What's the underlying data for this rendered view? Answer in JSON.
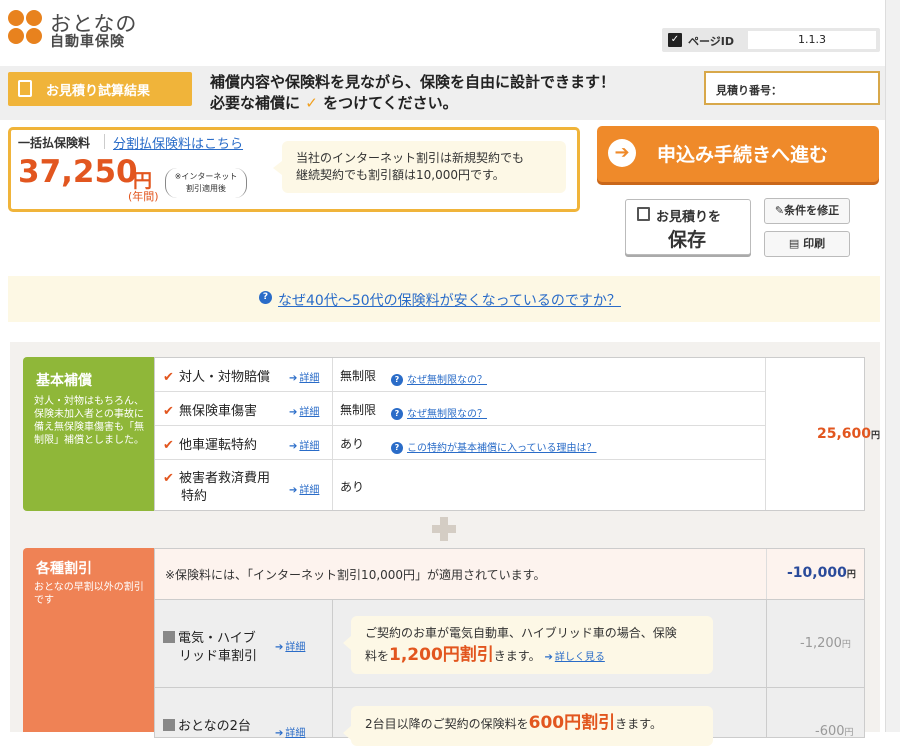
{
  "header": {
    "logo_line1": "おとなの",
    "logo_line2": "自動車保険",
    "page_id_label": "ページID",
    "page_id_value": "1.1.3"
  },
  "band": {
    "tag_label": "お見積り試算結果",
    "line1": "補償内容や保険料を見ながら、保険を自由に設計できます！",
    "line2_pre": "必要な補償に",
    "line2_check": "✓",
    "line2_post": "をつけてください。",
    "quote_number_label": "見積り番号："
  },
  "price": {
    "label": "一括払保険料",
    "installment_link": "分割払保険料はこちら",
    "amount": "37,250",
    "yen": "円",
    "per_year": "(年間)",
    "note_line1": "※インターネット",
    "note_line2": "割引適用後",
    "bubble_line1": "当社のインターネット割引は新規契約でも",
    "bubble_line2": "継続契約でも割引額は10,000円です。"
  },
  "actions": {
    "apply_label": "申込み手続きへ進む",
    "save_line1": "お見積りを",
    "save_line2": "保存",
    "edit_label": "条件を修正",
    "print_label": "印刷"
  },
  "faq": {
    "text": "なぜ40代〜50代の保険料が安くなっているのですか？"
  },
  "basic": {
    "title": "基本補償",
    "desc": "対人・対物はもちろん、保険未加入者との事故に備え無保険車傷害も「無制限」補償としました。",
    "total": "25,600",
    "total_unit": "円",
    "detail_label": "詳細",
    "rows": [
      {
        "name": "対人・対物賠償",
        "value": "無制限",
        "link": "なぜ無制限なの？"
      },
      {
        "name": "無保険車傷害",
        "value": "無制限",
        "link": "なぜ無制限なの？"
      },
      {
        "name": "他車運転特約",
        "value": "あり",
        "link": "この特約が基本補償に入っている理由は？"
      },
      {
        "name_l1": "被害者救済費用",
        "name_l2": "特約",
        "value": "あり"
      }
    ]
  },
  "discounts": {
    "title": "各種割引",
    "desc": "おとなの早割以外の割引です",
    "internet_text": "※保険料には、「インターネット割引10,000円」が適用されています。",
    "internet_amount": "-10,000",
    "unit": "円",
    "rows": [
      {
        "name_l1": "電気・ハイブ",
        "name_l2": "リッド車割引",
        "detail": "詳細",
        "bubble_l1": "ご契約のお車が電気自動車、ハイブリッド車の場合、保険",
        "bubble_pre": "料を",
        "bubble_hl": "1,200円割引",
        "bubble_post": "きます。",
        "bubble_link": "詳しく見る",
        "amount": "-1,200"
      },
      {
        "name_l1": "おとなの2台",
        "detail": "詳細",
        "bubble_l1_pre": "2台目以降のご契約の保険料を",
        "bubble_hl": "600円割引",
        "bubble_post": "きます。",
        "amount": "-600"
      }
    ]
  }
}
